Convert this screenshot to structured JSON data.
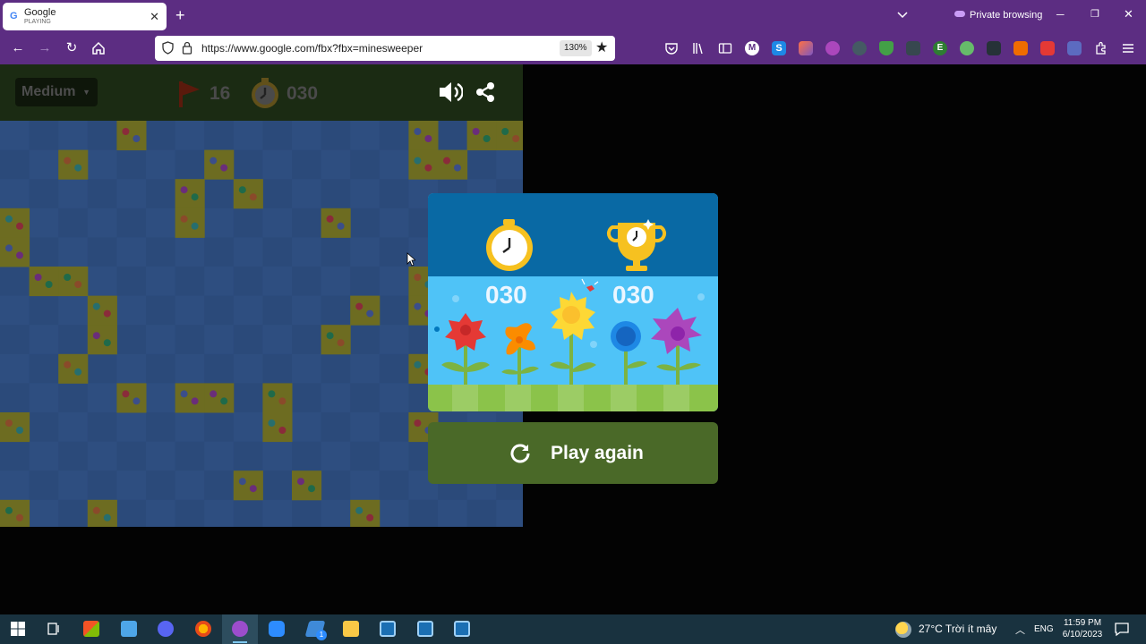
{
  "browser": {
    "tab": {
      "title": "Google",
      "subtitle": "PLAYING",
      "favicon": "G"
    },
    "new_tab_icon": "+",
    "private_label": "Private browsing",
    "url": "https://www.google.com/fbx?fbx=minesweeper",
    "zoom": "130%",
    "accent": "#5c2d82"
  },
  "game": {
    "difficulty": "Medium",
    "flags": "16",
    "time": "030",
    "colors": {
      "board_tile": "#2e4e80",
      "revealed": "#6d6c21"
    }
  },
  "result": {
    "current_time": "030",
    "best_time": "030",
    "play_again_label": "Play again"
  },
  "taskbar": {
    "weather": "27°C  Trời ít mây",
    "language": "ENG",
    "time": "11:59 PM",
    "date": "6/10/2023",
    "badge": "1"
  }
}
